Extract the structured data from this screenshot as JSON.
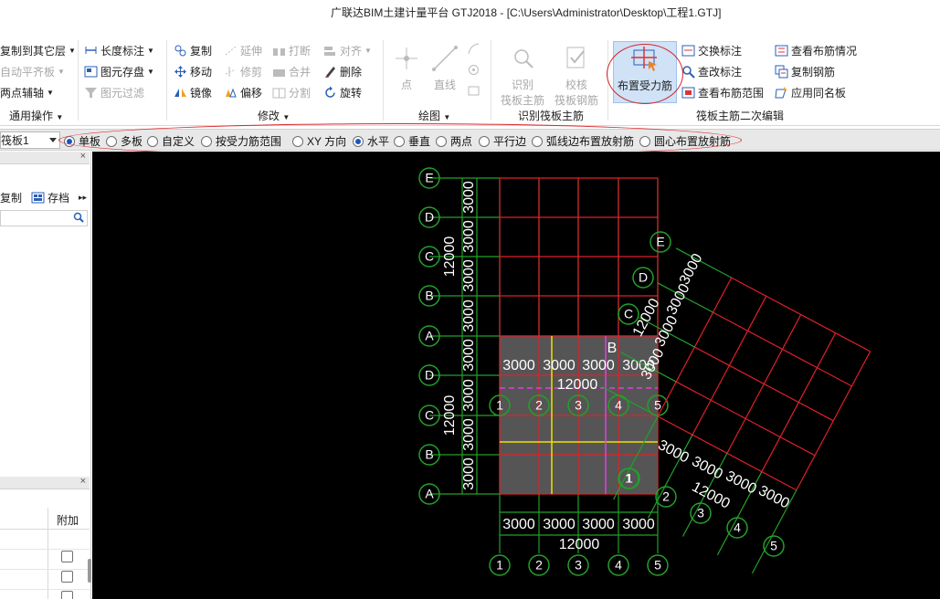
{
  "window": {
    "title": "广联达BIM土建计量平台 GTJ2018 - [C:\\Users\\Administrator\\Desktop\\工程1.GTJ]"
  },
  "ribbon": {
    "common_ops": {
      "items": [
        {
          "label": "复制到其它层",
          "has_arrow": true,
          "disabled": false
        },
        {
          "label": "自动平齐板",
          "has_arrow": true,
          "disabled": true
        },
        {
          "label": "两点辅轴",
          "has_arrow": true,
          "disabled": false
        }
      ],
      "group_label": "通用操作"
    },
    "mid_ops": {
      "items": [
        {
          "label": "长度标注",
          "has_arrow": true,
          "disabled": false
        },
        {
          "label": "图元存盘",
          "has_arrow": true,
          "disabled": false
        },
        {
          "label": "图元过滤",
          "has_arrow": false,
          "disabled": true
        }
      ]
    },
    "modify": {
      "col1": [
        {
          "label": "复制",
          "disabled": false
        },
        {
          "label": "移动",
          "disabled": false
        },
        {
          "label": "镜像",
          "disabled": false
        }
      ],
      "col2": [
        {
          "label": "延伸",
          "disabled": true
        },
        {
          "label": "修剪",
          "disabled": true
        },
        {
          "label": "偏移",
          "disabled": false
        }
      ],
      "col3": [
        {
          "label": "打断",
          "disabled": true
        },
        {
          "label": "合并",
          "disabled": true
        },
        {
          "label": "分割",
          "disabled": true
        }
      ],
      "col4": [
        {
          "label": "对齐",
          "disabled": true
        },
        {
          "label": "删除",
          "disabled": false
        },
        {
          "label": "旋转",
          "disabled": false
        }
      ],
      "group_label": "修改"
    },
    "draw": {
      "point_label": "点",
      "line_label": "直线",
      "group_label": "绘图"
    },
    "identify": {
      "identify_label_1": "识别",
      "identify_label_2": "筏板主筋",
      "check_label_1": "校核",
      "check_label_2": "筏板钢筋",
      "group_label": "识别筏板主筋"
    },
    "secondary": {
      "place_label": "布置受力筋",
      "col1": [
        {
          "label": "交换标注"
        },
        {
          "label": "查改标注"
        },
        {
          "label": "查看布筋范围"
        }
      ],
      "col2": [
        {
          "label": "查看布筋情况"
        },
        {
          "label": "复制钢筋"
        },
        {
          "label": "应用同名板"
        }
      ],
      "group_label": "筏板主筋二次编辑"
    }
  },
  "optionbar": {
    "combo_value": "筏板1",
    "radios": [
      {
        "label": "单板",
        "checked": true
      },
      {
        "label": "多板",
        "checked": false
      },
      {
        "label": "自定义",
        "checked": false
      },
      {
        "label": "按受力筋范围",
        "checked": false
      },
      {
        "label": "XY 方向",
        "checked": false
      },
      {
        "label": "水平",
        "checked": true
      },
      {
        "label": "垂直",
        "checked": false
      },
      {
        "label": "两点",
        "checked": false
      },
      {
        "label": "平行边",
        "checked": false
      },
      {
        "label": "弧线边布置放射筋",
        "checked": false
      },
      {
        "label": "圆心布置放射筋",
        "checked": false
      }
    ]
  },
  "leftpanel": {
    "close": "×",
    "copy_label": "复制",
    "save_label": "存档",
    "more": "▸▸",
    "table_header": "附加"
  },
  "canvas": {
    "colors": {
      "grid_red": "#e0202a",
      "axis_green": "#22a02a",
      "slab_fill": "#555555",
      "yellow": "#f2e000",
      "magenta": "#e040e0",
      "bg": "#000000"
    },
    "dims": {
      "span": "3000",
      "total": "12000",
      "dim_b": "B"
    },
    "axes_vertical": [
      "1",
      "2",
      "3",
      "4",
      "5"
    ],
    "axes_horizontal": [
      "A",
      "B",
      "C",
      "D",
      "E"
    ],
    "slab_label": "1"
  }
}
